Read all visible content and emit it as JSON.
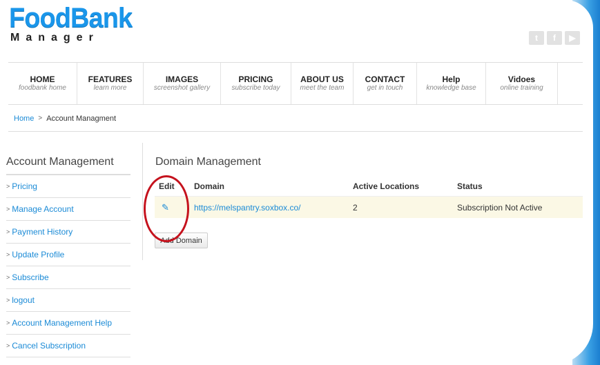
{
  "logo": {
    "main": "FoodBank",
    "sub": "Manager"
  },
  "social": [
    {
      "icon": "twitter-icon",
      "glyph": "t"
    },
    {
      "icon": "facebook-icon",
      "glyph": "f"
    },
    {
      "icon": "youtube-icon",
      "glyph": "▶"
    }
  ],
  "nav": [
    {
      "title": "HOME",
      "sub": "foodbank home"
    },
    {
      "title": "FEATURES",
      "sub": "learn more"
    },
    {
      "title": "IMAGES",
      "sub": "screenshot gallery"
    },
    {
      "title": "PRICING",
      "sub": "subscribe today"
    },
    {
      "title": "ABOUT US",
      "sub": "meet the team"
    },
    {
      "title": "CONTACT",
      "sub": "get in touch"
    },
    {
      "title": "Help",
      "sub": "knowledge base"
    },
    {
      "title": "Vidoes",
      "sub": "online training"
    }
  ],
  "breadcrumb": {
    "home": "Home",
    "sep": ">",
    "current": "Account Managment"
  },
  "sidebar": {
    "title": "Account Management",
    "items": [
      "Pricing",
      "Manage Account",
      "Payment History",
      "Update Profile",
      "Subscribe",
      "logout",
      "Account Management Help",
      "Cancel Subscription"
    ]
  },
  "main": {
    "title": "Domain Management",
    "headers": {
      "edit": "Edit",
      "domain": "Domain",
      "locations": "Active Locations",
      "status": "Status"
    },
    "rows": [
      {
        "domain": "https://melspantry.soxbox.co/",
        "locations": "2",
        "status": "Subscription Not Active"
      }
    ],
    "add_button": "Add Domain"
  },
  "colors": {
    "accent": "#1a8ad6",
    "logo": "#1a96ea",
    "highlight": "#c5121d",
    "row_bg": "#fbf8e5"
  }
}
